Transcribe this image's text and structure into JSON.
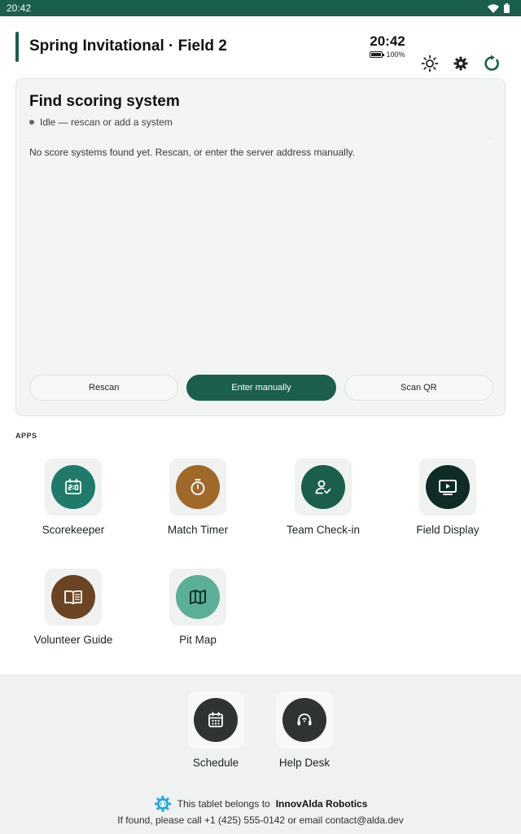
{
  "statusbar": {
    "time": "20:42"
  },
  "header": {
    "title": "Spring Invitational · Field 2",
    "clock": "20:42",
    "battery_level": "100%",
    "battery_fraction": 1.0
  },
  "scoring": {
    "title": "Find scoring system",
    "status": "Idle — rescan or add a system",
    "message": "No score systems found yet. Rescan, or enter the server address manually.",
    "buttons": {
      "rescan": "Rescan",
      "enter_manually": "Enter manually",
      "scan_qr": "Scan QR"
    }
  },
  "apps": {
    "section_label": "APPS",
    "items": [
      {
        "label": "Scorekeeper",
        "icon": "scoreboard-icon",
        "color": "#1f7a6a"
      },
      {
        "label": "Match Timer",
        "icon": "stopwatch-icon",
        "color": "#a0692a"
      },
      {
        "label": "Team Check-in",
        "icon": "person-check-icon",
        "color": "#1b5e4c"
      },
      {
        "label": "Field Display",
        "icon": "monitor-play-icon",
        "color": "#0f2b26"
      },
      {
        "label": "Volunteer Guide",
        "icon": "book-icon",
        "color": "#6b4423"
      },
      {
        "label": "Pit Map",
        "icon": "map-icon",
        "color": "#5bae98"
      }
    ]
  },
  "dock": {
    "items": [
      {
        "label": "Schedule",
        "icon": "calendar-icon",
        "color": "#2f3432"
      },
      {
        "label": "Help Desk",
        "icon": "headset-icon",
        "color": "#2f3432"
      }
    ]
  },
  "footer": {
    "owner_prefix": "This tablet belongs to",
    "owner_name": "InnovAlda Robotics",
    "contact": "If found, please call +1 (425) 555-0142 or email contact@alda.dev"
  },
  "colors": {
    "primary": "#1b5e4c",
    "card_bg": "#f3f5f4",
    "footer_bg": "#eff2f1"
  }
}
